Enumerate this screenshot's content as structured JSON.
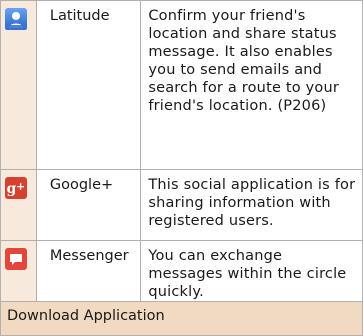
{
  "apps": [
    {
      "icon": "latitude-person-icon",
      "name": "Latitude",
      "description": "Confirm your friend's location and share status message. It also enables you to send emails and search for a route to your friend's location. (P206)"
    },
    {
      "icon": "google-plus-icon",
      "name": "Google+",
      "description": "This social application is for sharing information with registered users."
    },
    {
      "icon": "messenger-chat-icon",
      "name": "Messenger",
      "description": "You can exchange messages within the circle quickly."
    }
  ],
  "section": {
    "title": "Download Application"
  },
  "colors": {
    "icon_column_bg": "#f7eadc",
    "section_bg": "#f2dac2",
    "border": "#b1b1b1",
    "google_plus_red": "#d6402f",
    "latitude_blue": "#3f7fd8"
  }
}
